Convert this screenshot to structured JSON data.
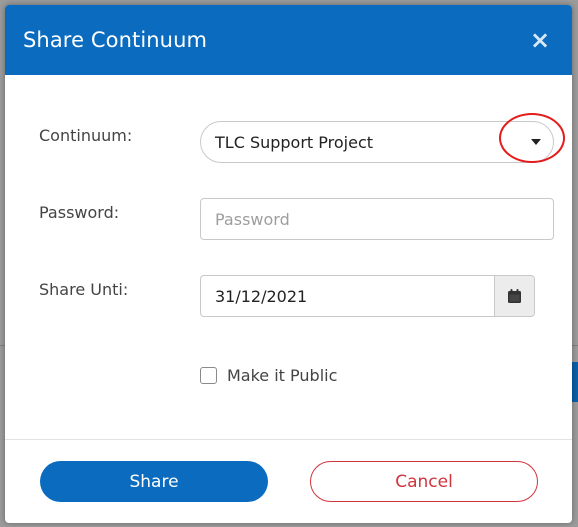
{
  "dialog": {
    "title": "Share Continuum",
    "close_label": "×"
  },
  "form": {
    "continuum": {
      "label": "Continuum:",
      "selected": "TLC Support Project"
    },
    "password": {
      "label": "Password:",
      "placeholder": "Password",
      "value": ""
    },
    "share_until": {
      "label": "Share Unti:",
      "value": "31/12/2021"
    },
    "make_public": {
      "label": "Make it Public",
      "checked": false
    }
  },
  "footer": {
    "share_label": "Share",
    "cancel_label": "Cancel"
  },
  "colors": {
    "header_bg": "#0a6bbf",
    "primary": "#0a6bbf",
    "danger": "#d0343c",
    "annotation": "#e31c1c"
  },
  "icons": {
    "close": "close-icon",
    "dropdown": "caret-down-icon",
    "calendar": "calendar-icon"
  }
}
